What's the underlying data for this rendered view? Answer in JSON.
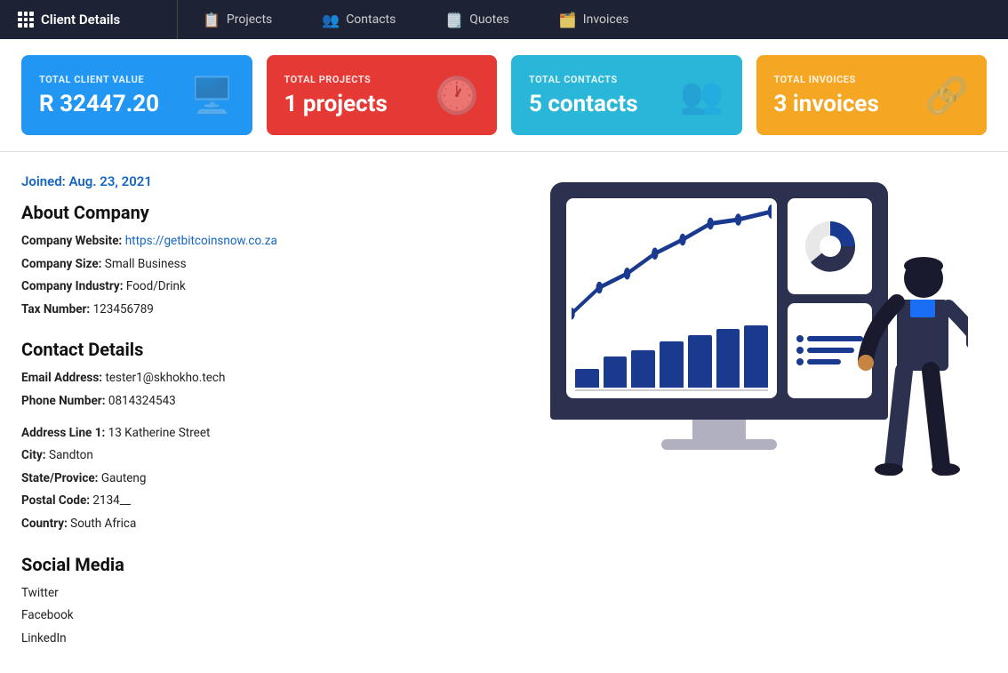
{
  "nav": {
    "brand": "Client Details",
    "tabs": [
      {
        "label": "Projects",
        "icon": "📋",
        "key": "projects"
      },
      {
        "label": "Contacts",
        "icon": "👥",
        "key": "contacts"
      },
      {
        "label": "Quotes",
        "icon": "🗒️",
        "key": "quotes"
      },
      {
        "label": "Invoices",
        "icon": "🗂️",
        "key": "invoices"
      }
    ]
  },
  "stats": [
    {
      "label": "TOTAL CLIENT VALUE",
      "value": "R 32447.20",
      "color": "blue",
      "icon": "🖥️"
    },
    {
      "label": "TOTAL PROJECTS",
      "value": "1 projects",
      "color": "red",
      "icon": "🕐"
    },
    {
      "label": "TOTAL CONTACTS",
      "value": "5 contacts",
      "color": "cyan",
      "icon": "👥"
    },
    {
      "label": "TOTAL INVOICES",
      "value": "3 invoices",
      "color": "orange",
      "icon": "🔗"
    }
  ],
  "client": {
    "joined": "Joined: Aug. 23, 2021",
    "about_title": "About Company",
    "company_website_label": "Company Website:",
    "company_website_url": "https://getbitcoinsnow.co.za",
    "company_website_text": "https://getbitcoinsnow.co.za",
    "company_size_label": "Company Size:",
    "company_size": "Small Business",
    "company_industry_label": "Company Industry:",
    "company_industry": "Food/Drink",
    "tax_number_label": "Tax Number:",
    "tax_number": "123456789",
    "contact_title": "Contact Details",
    "email_label": "Email Address:",
    "email": "tester1@skhokho.tech",
    "phone_label": "Phone Number:",
    "phone": "0814324543",
    "address1_label": "Address Line 1:",
    "address1": "13 Katherine Street",
    "city_label": "City:",
    "city": "Sandton",
    "state_label": "State/Provice:",
    "state": "Gauteng",
    "postal_label": "Postal Code:",
    "postal": "2134__",
    "country_label": "Country:",
    "country": "South Africa",
    "social_title": "Social Media",
    "social": [
      "Twitter",
      "Facebook",
      "LinkedIn"
    ]
  }
}
